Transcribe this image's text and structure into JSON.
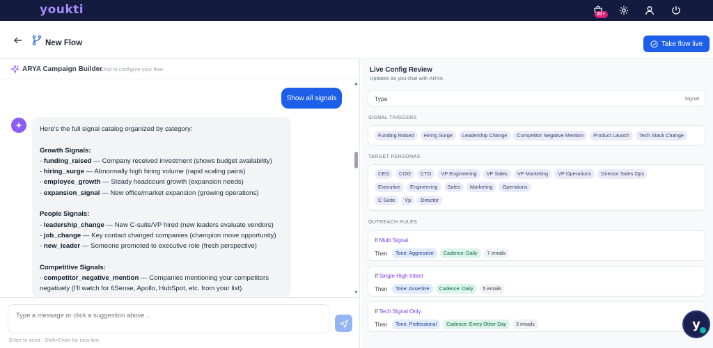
{
  "brand": {
    "logo": "youkti",
    "credits": "20⚡"
  },
  "topnav": {
    "icons": [
      "shopping-bag-icon",
      "gear-icon",
      "user-icon",
      "power-icon"
    ]
  },
  "header": {
    "title": "New Flow",
    "take_live_label": "Take flow live"
  },
  "builder": {
    "title": "ARYA Campaign Builder",
    "subtitle": "- Chat to configure your flow"
  },
  "chat": {
    "user_message": "Show all signals",
    "assistant_lines": [
      {
        "pre": "Here's the full signal catalog organized by category:",
        "bold": "",
        "post": ""
      },
      {
        "pre": "",
        "bold": "",
        "post": ""
      },
      {
        "pre": "",
        "bold": "Growth Signals:",
        "post": ""
      },
      {
        "pre": "- ",
        "bold": "funding_raised",
        "post": " — Company received investment (shows budget availability)"
      },
      {
        "pre": "- ",
        "bold": "hiring_surge",
        "post": " — Abnormally high hiring volume (rapid scaling pains)"
      },
      {
        "pre": "- ",
        "bold": "employee_growth",
        "post": " — Steady headcount growth (expansion needs)"
      },
      {
        "pre": "- ",
        "bold": "expansion_signal",
        "post": " — New office/market expansion (growing operations)"
      },
      {
        "pre": "",
        "bold": "",
        "post": ""
      },
      {
        "pre": "",
        "bold": "People Signals:",
        "post": ""
      },
      {
        "pre": "- ",
        "bold": "leadership_change",
        "post": " — New C-suite/VP hired (new leaders evaluate vendors)"
      },
      {
        "pre": "- ",
        "bold": "job_change",
        "post": " — Key contact changed companies (champion move opportunity)"
      },
      {
        "pre": "- ",
        "bold": "new_leader",
        "post": " — Someone promoted to executive role (fresh perspective)"
      },
      {
        "pre": "",
        "bold": "",
        "post": ""
      },
      {
        "pre": "",
        "bold": "Competitive Signals:",
        "post": ""
      },
      {
        "pre": "- ",
        "bold": "competitor_negative_mention",
        "post": " — Companies mentioning your competitors"
      },
      {
        "pre": "negatively (I'll watch for 6Sense, Apollo, HubSpot, etc. from your list)",
        "bold": "",
        "post": ""
      }
    ]
  },
  "composer": {
    "placeholder": "Type a message or click a suggestion above...",
    "hint": "Enter to send · Shift+Enter for new line"
  },
  "review": {
    "title": "Live Config Review",
    "subtitle": "Updates as you chat with ARYA",
    "type_label": "Type",
    "type_value": "Signal",
    "signal_triggers_label": "SIGNAL TRIGGERS",
    "signal_triggers": [
      "Funding Raised",
      "Hiring Surge",
      "Leadership Change",
      "Competitor Negative Mention",
      "Product Launch",
      "Tech Stack Change"
    ],
    "target_personas_label": "TARGET PERSONAS",
    "personas_row1": [
      "CEO",
      "COO",
      "CTO",
      "VP Engineering",
      "VP Sales",
      "VP Marketing",
      "VP Operations",
      "Director Sales Ops"
    ],
    "personas_row2": [
      "Executive",
      "Engineering",
      "Sales",
      "Marketing",
      "Operations"
    ],
    "personas_row3": [
      "C Suite",
      "Vp",
      "Director"
    ],
    "outreach_rules_label": "OUTREACH RULES",
    "rules": [
      {
        "if": "If",
        "condition": "Multi Signal",
        "then": "Then",
        "tone": "Tone: Aggressive",
        "cadence": "Cadence: Daily",
        "count": "7 emails"
      },
      {
        "if": "If",
        "condition": "Single High Intent",
        "then": "Then",
        "tone": "Tone: Assertive",
        "cadence": "Cadence: Daily",
        "count": "5 emails"
      },
      {
        "if": "If",
        "condition": "Tech Signal Only",
        "then": "Then",
        "tone": "Tone: Professional",
        "cadence": "Cadence: Every Other Day",
        "count": "3 emails"
      }
    ]
  },
  "fab": {
    "label": "y"
  },
  "colors": {
    "nav_bg": "#131b3f",
    "primary": "#1d5fe8",
    "accent_purple": "#7c3aed",
    "chip_bg": "#e9ecf8"
  }
}
